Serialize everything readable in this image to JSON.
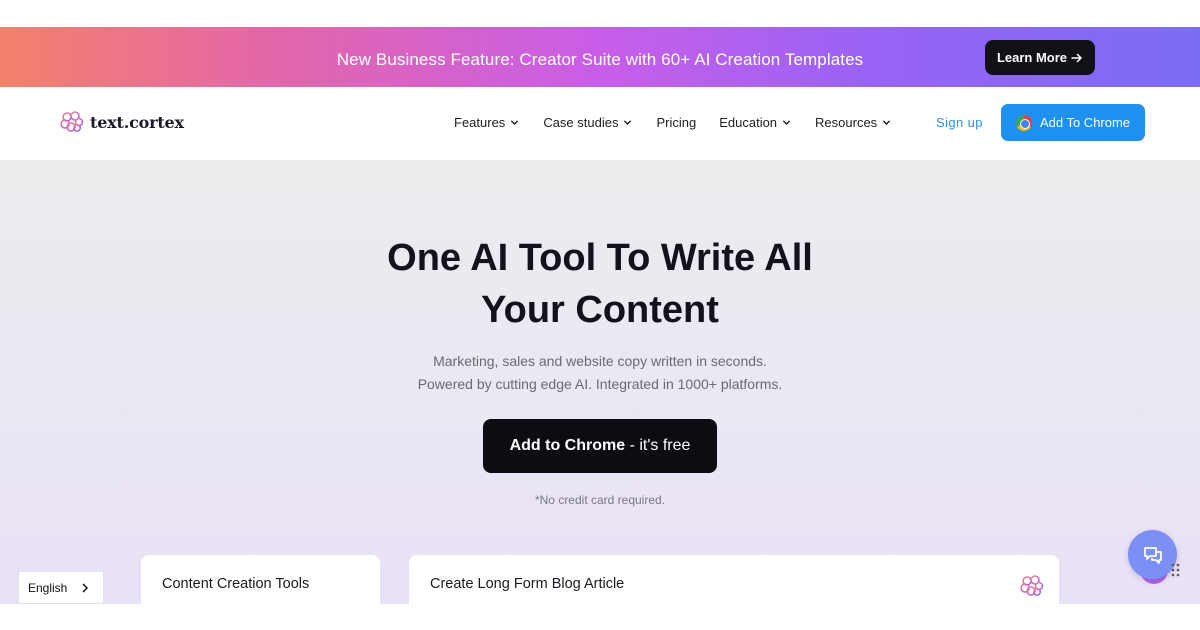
{
  "promo": {
    "text": "New Business Feature: Creator Suite with 60+ AI Creation Templates",
    "button_label": "Learn More",
    "button_icon": "arrow-right-icon"
  },
  "nav": {
    "logo_text": "text.cortex",
    "logo_icon": "brain-logo-icon",
    "items": [
      {
        "label": "Features",
        "has_dropdown": true
      },
      {
        "label": "Case studies",
        "has_dropdown": true
      },
      {
        "label": "Pricing",
        "has_dropdown": false
      },
      {
        "label": "Education",
        "has_dropdown": true
      },
      {
        "label": "Resources",
        "has_dropdown": true
      }
    ],
    "signup_label": "Sign up",
    "chrome_button_label": "Add To Chrome"
  },
  "hero": {
    "title_line1": "One AI Tool To Write All",
    "title_line2": "Your Content",
    "subtitle_line1": "Marketing, sales and website copy written in seconds.",
    "subtitle_line2": "Powered by cutting edge AI. Integrated in 1000+ platforms.",
    "cta_bold": "Add to Chrome",
    "cta_light": " - it's free",
    "note": "*No credit card required."
  },
  "cards": {
    "left_title": "Content Creation Tools",
    "right_title": "Create Long Form Blog Article"
  },
  "language": {
    "selected": "English"
  },
  "colors": {
    "accent_blue": "#1e90f0",
    "cta_black": "#0c0c12",
    "chat_button": "#7c8ff5"
  }
}
